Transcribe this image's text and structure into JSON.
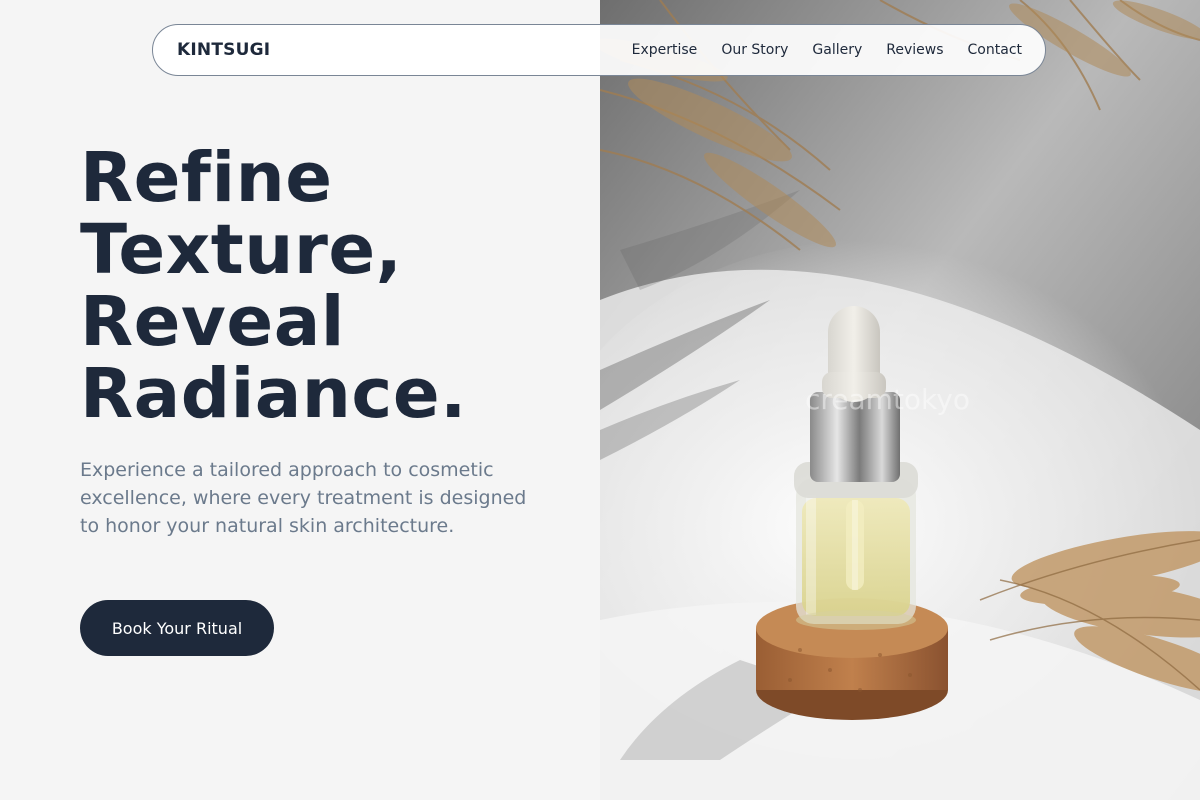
{
  "nav": {
    "brand": "KINTSUGI",
    "links": [
      "Expertise",
      "Our Story",
      "Gallery",
      "Reviews",
      "Contact"
    ]
  },
  "hero": {
    "title_lines": [
      "Refine",
      "Texture,",
      "Reveal",
      "Radiance."
    ],
    "subtitle": "Experience a tailored approach to cosmetic excellence, where every treatment is designed to honor your natural skin architecture.",
    "cta_label": "Book Your Ritual"
  },
  "image": {
    "watermark": "creamtokyo"
  },
  "colors": {
    "primary": "#1e293b",
    "muted_text": "#6b7a8c",
    "background": "#f5f5f5"
  }
}
